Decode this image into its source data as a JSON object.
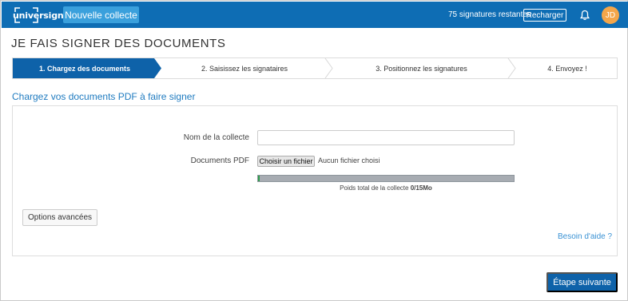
{
  "header": {
    "logo_text": "universign",
    "new_button": "Nouvelle collecte",
    "signatures_left": "75 signatures restantes",
    "recharge_button": "Recharger",
    "avatar_initials": "JD",
    "brand_color": "#0e6db4",
    "icons": [
      "bell-icon"
    ]
  },
  "page": {
    "title": "JE FAIS SIGNER DES DOCUMENTS"
  },
  "steps": [
    {
      "label": "1. Chargez des documents",
      "active": true
    },
    {
      "label": "2. Saisissez les signataires",
      "active": false
    },
    {
      "label": "3. Positionnez les signatures",
      "active": false
    },
    {
      "label": "4. Envoyez !",
      "active": false
    }
  ],
  "upload": {
    "section_title": "Chargez vos documents PDF à faire signer",
    "collection_name_label": "Nom de la collecte",
    "collection_name_value": "",
    "documents_label": "Documents PDF",
    "file_button": "Choisir un fichier",
    "file_status": "Aucun fichier choisi",
    "progress_fraction": 0.005,
    "weight_prefix": "Poids total de la collecte",
    "weight_value": "0/15Mo",
    "advanced_button": "Options avancées",
    "help_link": "Besoin d'aide ?"
  },
  "footer": {
    "next_button": "Étape suivante"
  }
}
